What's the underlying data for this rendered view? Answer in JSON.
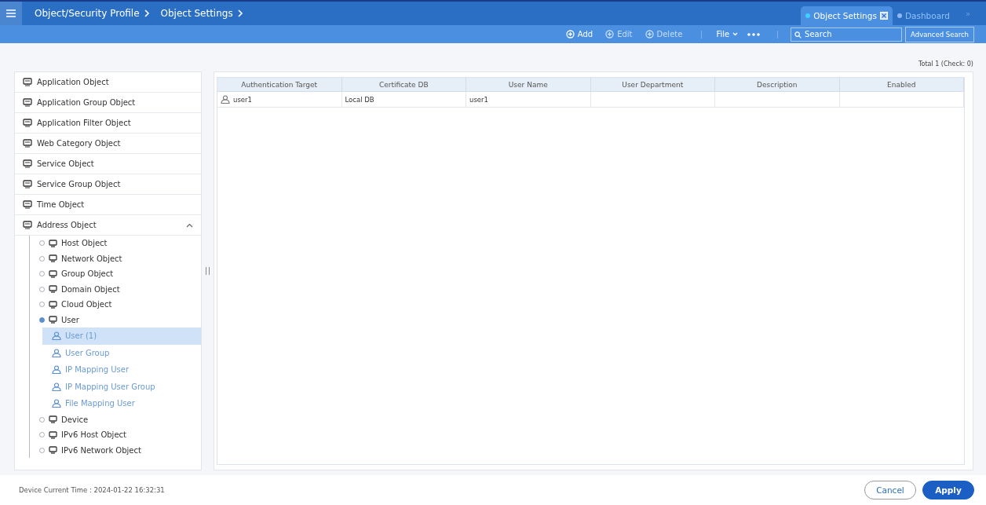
{
  "header": {
    "breadcrumbs": [
      "Object/Security Profile",
      "Object Settings"
    ],
    "tabs": [
      {
        "label": "Object Settings",
        "selected": true
      },
      {
        "label": "Dashboard",
        "selected": false
      }
    ],
    "overflow": "»"
  },
  "toolbar": {
    "actions": [
      {
        "label": "Add",
        "disabled": false
      },
      {
        "label": "Edit",
        "disabled": true
      },
      {
        "label": "Delete",
        "disabled": true
      }
    ],
    "file": "File",
    "search": {
      "placeholder": "Search"
    },
    "advanced": "Advanced Search"
  },
  "total": "Total 1 (Check: 0)",
  "sidebar": {
    "items": [
      {
        "label": "Application Object"
      },
      {
        "label": "Application Group Object"
      },
      {
        "label": "Application Filter Object"
      },
      {
        "label": "Web Category Object"
      },
      {
        "label": "Service Object"
      },
      {
        "label": "Service Group Object"
      },
      {
        "label": "Time Object"
      },
      {
        "label": "Address Object",
        "expanded": true,
        "children": [
          {
            "label": "Host Object"
          },
          {
            "label": "Network Object"
          },
          {
            "label": "Group Object"
          },
          {
            "label": "Domain Object"
          },
          {
            "label": "Cloud Object"
          },
          {
            "label": "User",
            "expanded": true,
            "children": [
              {
                "label": "User (1)",
                "selected": true
              },
              {
                "label": "User Group",
                "selected": false
              },
              {
                "label": "IP Mapping User",
                "selected": false
              },
              {
                "label": "IP Mapping User Group",
                "selected": false
              },
              {
                "label": "File Mapping User",
                "selected": false
              }
            ]
          },
          {
            "label": "Device"
          },
          {
            "label": "IPv6 Host Object"
          },
          {
            "label": "IPv6 Network Object"
          }
        ]
      }
    ]
  },
  "table": {
    "columns": [
      "Authentication Target",
      "Certificate DB",
      "User Name",
      "User Department",
      "Description",
      "Enabled"
    ],
    "rows": [
      [
        "user1",
        "Local DB",
        "user1",
        "",
        "",
        ""
      ]
    ]
  },
  "footer": {
    "time": "Device Current Time : 2024-01-22 16:32:31",
    "buttons": [
      {
        "label": "Cancel",
        "kind": "secondary"
      },
      {
        "label": "Apply",
        "kind": "primary"
      }
    ]
  }
}
